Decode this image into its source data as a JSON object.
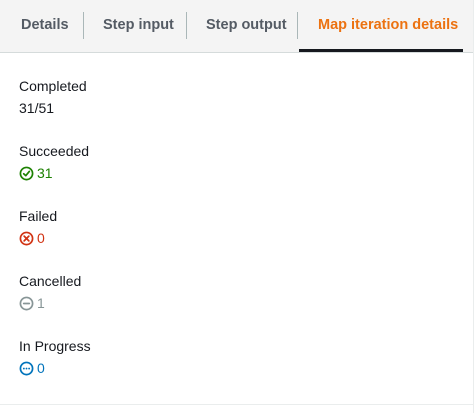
{
  "tabs": {
    "details": "Details",
    "step_input": "Step input",
    "step_output": "Step output",
    "map_iteration_details": "Map iteration details"
  },
  "stats": {
    "completed": {
      "label": "Completed",
      "value": "31/51"
    },
    "succeeded": {
      "label": "Succeeded",
      "value": "31",
      "icon": "check-circle-icon",
      "color": "#1d8102"
    },
    "failed": {
      "label": "Failed",
      "value": "0",
      "icon": "x-circle-icon",
      "color": "#d13212"
    },
    "cancelled": {
      "label": "Cancelled",
      "value": "1",
      "icon": "minus-circle-icon",
      "color": "#879596"
    },
    "in_progress": {
      "label": "In Progress",
      "value": "0",
      "icon": "ellipsis-circle-icon",
      "color": "#0073bb"
    }
  },
  "colors": {
    "active_tab": "#ec7211",
    "tab_text": "#545b64",
    "text": "#16191f"
  }
}
